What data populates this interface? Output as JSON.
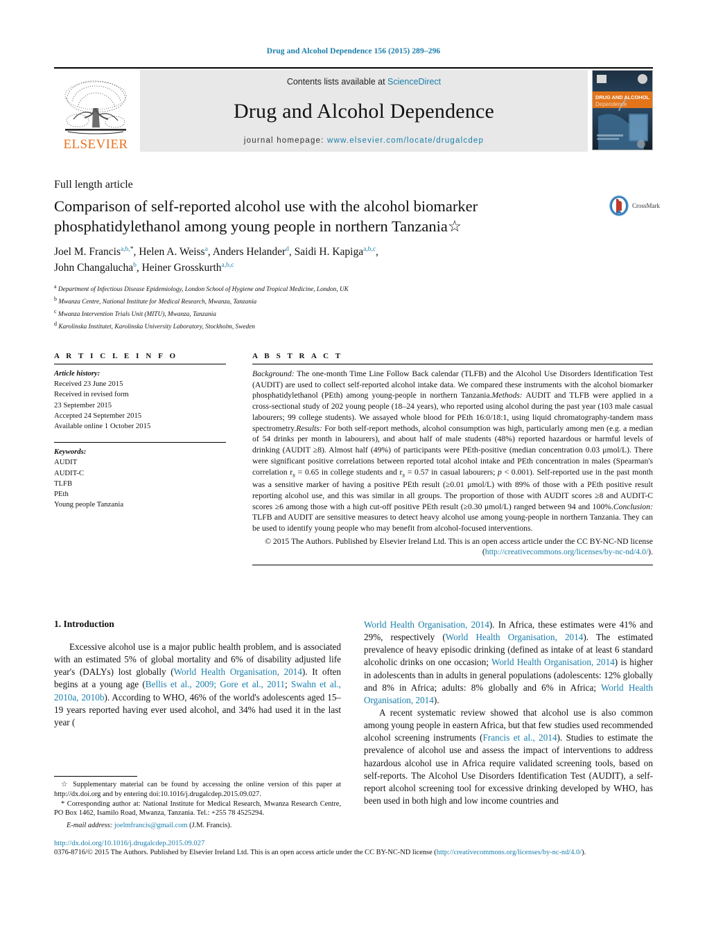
{
  "running_head": "Drug and Alcohol Dependence 156 (2015) 289–296",
  "masthead": {
    "publisher_name": "ELSEVIER",
    "contents_prefix": "Contents lists available at ",
    "contents_link": "ScienceDirect",
    "journal_title": "Drug and Alcohol Dependence",
    "homepage_prefix": "journal homepage: ",
    "homepage_link": "www.elsevier.com/locate/drugalcdep",
    "cover": {
      "line1": "DRUG AND ALCOHOL",
      "line2": "Dependence"
    }
  },
  "article_type": "Full length article",
  "title": "Comparison of self-reported alcohol use with the alcohol biomarker phosphatidylethanol among young people in northern Tanzania",
  "title_footnote_mark": "☆",
  "crossmark_label": "CrossMark",
  "authors": [
    {
      "name": "Joel M. Francis",
      "marks": "a,b,",
      "star": "*"
    },
    {
      "name": "Helen A. Weiss",
      "marks": "a"
    },
    {
      "name": "Anders Helander",
      "marks": "d"
    },
    {
      "name": "Saidi H. Kapiga",
      "marks": "a,b,c"
    },
    {
      "name": "John Changalucha",
      "marks": "b"
    },
    {
      "name": "Heiner Grosskurth",
      "marks": "a,b,c"
    }
  ],
  "affiliations": [
    {
      "mark": "a",
      "text": "Department of Infectious Disease Epidemiology, London School of Hygiene and Tropical Medicine, London, UK"
    },
    {
      "mark": "b",
      "text": "Mwanza Centre, National Institute for Medical Research, Mwanza, Tanzania"
    },
    {
      "mark": "c",
      "text": "Mwanza Intervention Trials Unit (MITU), Mwanza, Tanzania"
    },
    {
      "mark": "d",
      "text": "Karolinska Institutet, Karolinska University Laboratory, Stockholm, Sweden"
    }
  ],
  "article_info": {
    "heading": "A R T I C L E   I N F O",
    "history_label": "Article history:",
    "history": [
      "Received 23 June 2015",
      "Received in revised form",
      "23 September 2015",
      "Accepted 24 September 2015",
      "Available online 1 October 2015"
    ],
    "keywords_label": "Keywords:",
    "keywords": [
      "AUDIT",
      "AUDIT-C",
      "TLFB",
      "PEth",
      "Young people Tanzania"
    ]
  },
  "abstract": {
    "heading": "A B S T R A C T",
    "background_label": "Background:",
    "background_text": " The one-month Time Line Follow Back calendar (TLFB) and the Alcohol Use Disorders Identification Test (AUDIT) are used to collect self-reported alcohol intake data. We compared these instruments with the alcohol biomarker phosphatidylethanol (PEth) among young-people in northern Tanzania.",
    "methods_label": "Methods:",
    "methods_text": " AUDIT and TLFB were applied in a cross-sectional study of 202 young people (18–24 years), who reported using alcohol during the past year (103 male casual labourers; 99 college students). We assayed whole blood for PEth 16:0/18:1, using liquid chromatography-tandem mass spectrometry.",
    "results_label": "Results:",
    "results_text": " For both self-report methods, alcohol consumption was high, particularly among men (e.g. a median of 54 drinks per month in labourers), and about half of male students (48%) reported hazardous or harmful levels of drinking (AUDIT ≥8). Almost half (49%) of participants were PEth-positive (median concentration 0.03 μmol/L). There were significant positive correlations between reported total alcohol intake and PEth concentration in males (Spearman's correlation r",
    "results_text_b": " = 0.65 in college students and r",
    "results_text_c": " = 0.57 in casual labourers; ",
    "results_text_d": "p",
    "results_text_e": " < 0.001). Self-reported use in the past month was a sensitive marker of having a positive PEth result (≥0.01 μmol/L) with 89% of those with a PEth positive result reporting alcohol use, and this was similar in all groups. The proportion of those with AUDIT scores ≥8 and AUDIT-C scores ≥6 among those with a high cut-off positive PEth result (≥0.30 μmol/L) ranged between 94 and 100%.",
    "conclusion_label": "Conclusion:",
    "conclusion_text": " TLFB and AUDIT are sensitive measures to detect heavy alcohol use among young-people in northern Tanzania. They can be used to identify young people who may benefit from alcohol-focused interventions.",
    "copyright_text": "© 2015 The Authors. Published by Elsevier Ireland Ltd. This is an open access article under the CC BY-NC-ND license (",
    "copyright_link": "http://creativecommons.org/licenses/by-nc-nd/4.0/",
    "copyright_tail": ")."
  },
  "introduction": {
    "heading": "1. Introduction",
    "left_p1_a": "Excessive alcohol use is a major public health problem, and is associated with an estimated 5% of global mortality and 6% of disability adjusted life year's (DALYs) lost globally (",
    "left_p1_ref1": "World Health Organisation, 2014",
    "left_p1_b": "). It often begins at a young age (",
    "left_p1_ref2": "Bellis et al., 2009; Gore et al., 2011",
    "left_p1_c": "; ",
    "left_p1_ref3": "Swahn et al., 2010a, 2010b",
    "left_p1_d": "). According to WHO, 46% of the world's adolescents aged 15–19 years reported having ever used alcohol, and 34% had used it in the last year (",
    "right_p1_ref1": "World Health Organisation, 2014",
    "right_p1_a": "). In Africa, these estimates were 41% and 29%, respectively (",
    "right_p1_ref2": "World Health Organisation, 2014",
    "right_p1_b": "). The estimated prevalence of heavy episodic drinking (defined as intake of at least 6 standard alcoholic drinks on one occasion; ",
    "right_p1_ref3": "World Health Organisation, 2014",
    "right_p1_c": ") is higher in adolescents than in adults in general populations (adolescents: 12% globally and 8% in Africa; adults: 8% globally and 6% in Africa; ",
    "right_p1_ref4": "World Health Organisation, 2014",
    "right_p1_d": ").",
    "right_p2_a": "A recent systematic review showed that alcohol use is also common among young people in eastern Africa, but that few studies used recommended alcohol screening instruments (",
    "right_p2_ref1": "Francis et al., 2014",
    "right_p2_b": "). Studies to estimate the prevalence of alcohol use and assess the impact of interventions to address hazardous alcohol use in Africa require validated screening tools, based on self-reports. The Alcohol Use Disorders Identification Test (AUDIT), a self-report alcohol screening tool for excessive drinking developed by WHO, has been used in both high and low income countries and"
  },
  "footnotes": {
    "supplementary_mark": "☆",
    "supplementary_text": " Supplementary material can be found by accessing the online version of this paper at http://dx.doi.org and by entering doi:10.1016/j.drugalcdep.2015.09.027.",
    "corresponding_mark": "*",
    "corresponding_text": " Corresponding author at: National Institute for Medical Research, Mwanza Research Centre, PO Box 1462, Isamilo Road, Mwanza, Tanzania. Tel.: +255 78 4525294.",
    "email_label": "E-mail address:",
    "email_link": "joelmfrancis@gmail.com",
    "email_tail": " (J.M. Francis)."
  },
  "bottom": {
    "doi_link": "http://dx.doi.org/10.1016/j.drugalcdep.2015.09.027",
    "issn_a": "0376-8716/© 2015 The Authors. Published by Elsevier Ireland Ltd. This is an open access article under the CC BY-NC-ND license (",
    "issn_link": "http://creativecommons.org/licenses/by-nc-nd/4.0/",
    "issn_tail": ")."
  },
  "colors": {
    "link": "#1a7eab",
    "elsevier_orange": "#E9711C",
    "band_gray": "#e8e8e8"
  }
}
